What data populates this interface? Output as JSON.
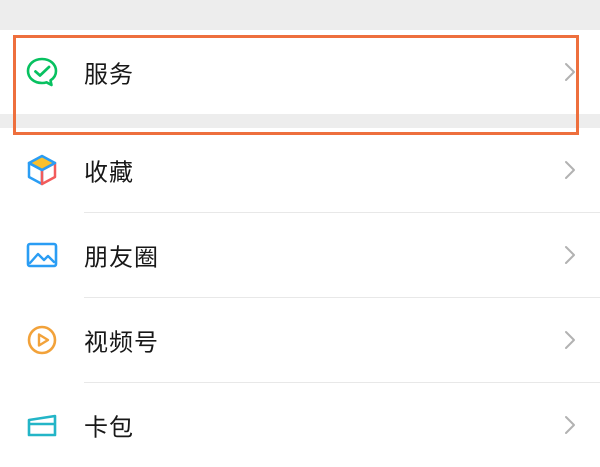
{
  "menu": {
    "service": {
      "label": "服务",
      "icon": "wechat-pay-icon"
    },
    "items": [
      {
        "label": "收藏",
        "icon": "favorites-cube-icon"
      },
      {
        "label": "朋友圈",
        "icon": "moments-picture-icon"
      },
      {
        "label": "视频号",
        "icon": "channels-play-icon"
      },
      {
        "label": "卡包",
        "icon": "card-wallet-icon"
      }
    ]
  },
  "colors": {
    "highlight": "#ee6f3d",
    "wechat_green": "#07c160",
    "background": "#ededed"
  }
}
